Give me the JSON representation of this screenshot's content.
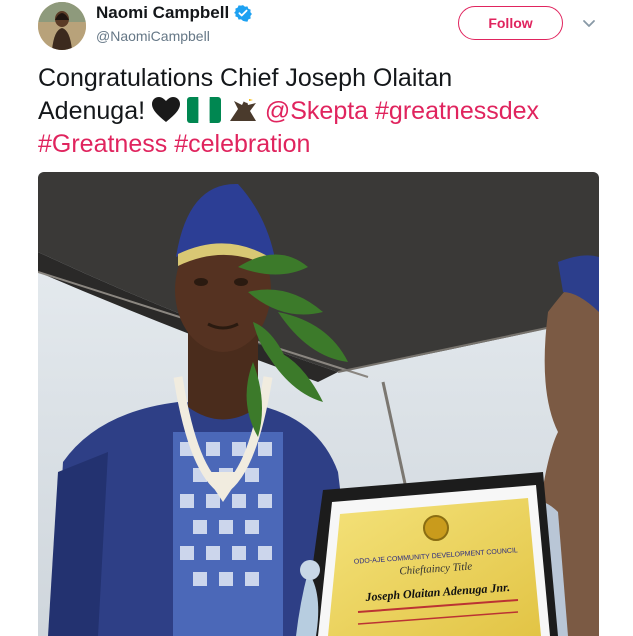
{
  "user": {
    "display_name": "Naomi Campbell",
    "handle": "@NaomiCampbell",
    "verified_icon": "verified-badge-icon",
    "avatar_icon": "profile-photo"
  },
  "actions": {
    "follow_label": "Follow",
    "more_icon": "chevron-down-icon"
  },
  "tweet": {
    "text_line1": "Congratulations Chief Joseph Olaitan",
    "text_line2": "Adenuga!",
    "emojis": [
      "black-heart-icon",
      "nigeria-flag-icon",
      "eagle-icon"
    ],
    "mention": "@Skepta",
    "hashtag1": "#greatnessdex",
    "hashtag2": "#Greatness",
    "hashtag3": "#celebration"
  },
  "media": {
    "icon": "photo-chieftaincy-ceremony",
    "certificate": {
      "council": "ODO-AJE COMMUNITY DEVELOPMENT COUNCIL",
      "title": "Chieftaincy Title",
      "name": "Joseph Olaitan Adenuga Jnr."
    }
  },
  "colors": {
    "accent": "#e0245e",
    "verified": "#1da1f2",
    "muted": "#657786"
  }
}
